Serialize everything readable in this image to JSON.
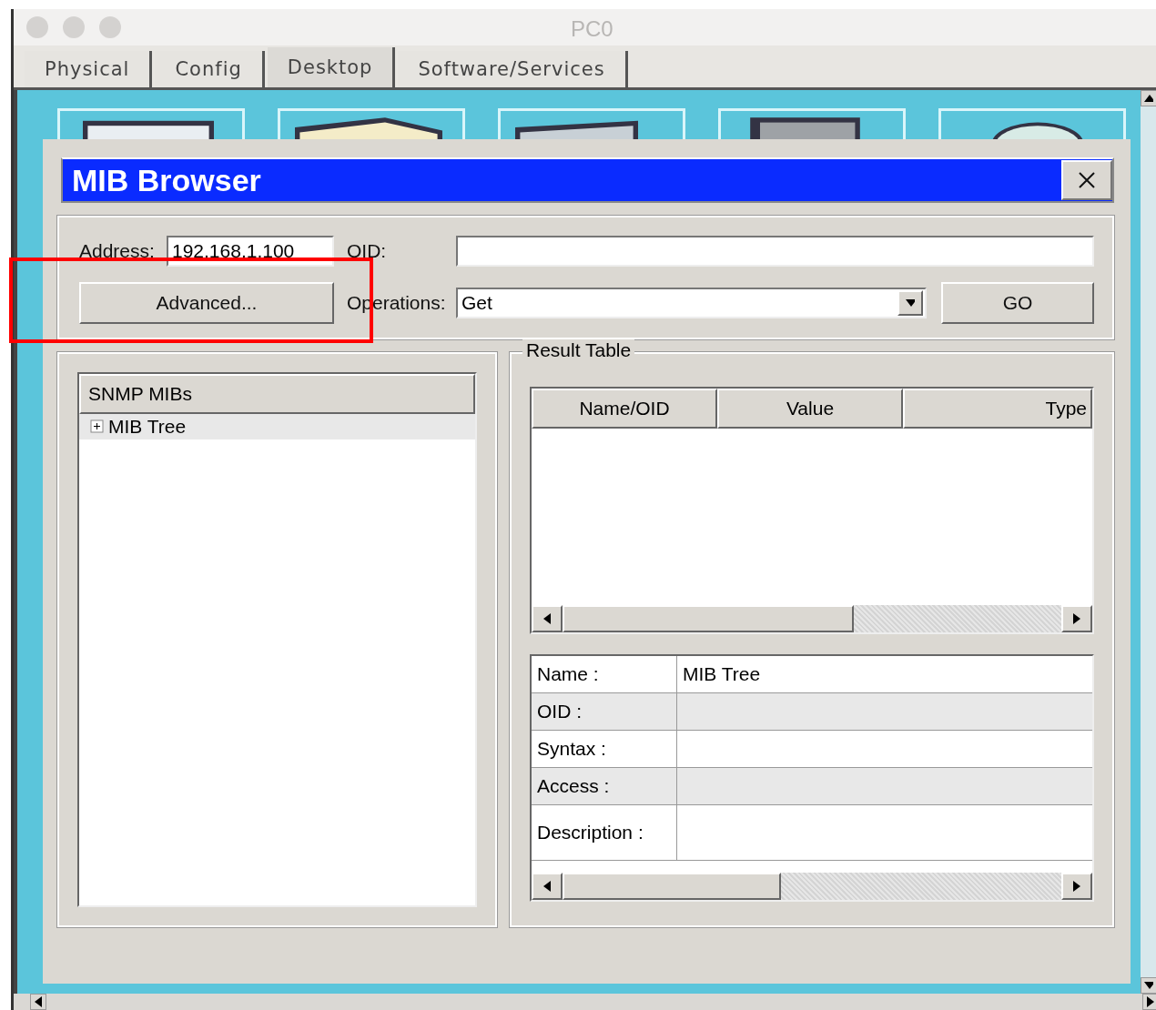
{
  "window": {
    "title": "PC0"
  },
  "tabs": [
    {
      "label": "Physical",
      "selected": false
    },
    {
      "label": "Config",
      "selected": false
    },
    {
      "label": "Desktop",
      "selected": true
    },
    {
      "label": "Software/Services",
      "selected": false
    }
  ],
  "dialog": {
    "title": "MIB Browser",
    "address": {
      "label": "Address:",
      "value": "192.168.1.100"
    },
    "oid": {
      "label": "OID:"
    },
    "advanced_button": "Advanced...",
    "operations": {
      "label": "Operations:",
      "value": "Get"
    },
    "go_button": "GO",
    "tree": {
      "header": "SNMP MIBs",
      "items": [
        {
          "label": "MIB Tree",
          "expanded": false,
          "selected": true
        }
      ]
    },
    "result_table": {
      "title": "Result Table",
      "columns": [
        "Name/OID",
        "Value",
        "Type"
      ]
    },
    "details": [
      {
        "label": "Name :",
        "value": "MIB Tree"
      },
      {
        "label": "OID :"
      },
      {
        "label": "Syntax :"
      },
      {
        "label": "Access :"
      },
      {
        "label": "Description :"
      }
    ]
  }
}
